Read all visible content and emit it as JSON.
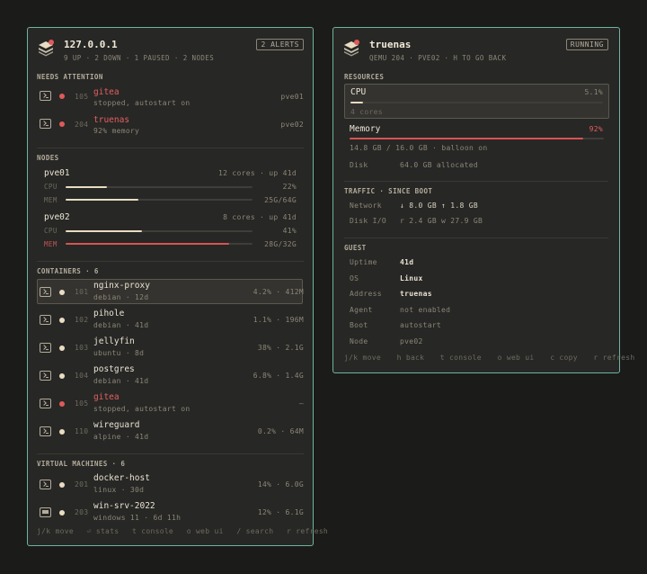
{
  "left": {
    "host": "127.0.0.1",
    "summary": "9 UP  ·  2 DOWN  ·  1 PAUSED  ·  2 NODES",
    "alerts_badge": "2 ALERTS",
    "attention": {
      "header": "NEEDS ATTENTION",
      "items": [
        {
          "id": "105",
          "name": "gitea",
          "detail": "stopped, autostart on",
          "node": "pve01"
        },
        {
          "id": "204",
          "name": "truenas",
          "detail": "92% memory",
          "node": "pve02"
        }
      ]
    },
    "nodes": {
      "header": "NODES",
      "items": [
        {
          "name": "pve01",
          "info": "12 cores  ·  up 41d",
          "cpu_label": "CPU",
          "cpu_pct": "22%",
          "cpu_level": 0.22,
          "mem_label": "MEM",
          "mem_val": "25G/64G",
          "mem_level": 0.39
        },
        {
          "name": "pve02",
          "info": "8 cores  ·  up 41d",
          "cpu_label": "CPU",
          "cpu_pct": "41%",
          "cpu_level": 0.41,
          "mem_label": "MEM",
          "mem_val": "28G/32G",
          "mem_level": 0.875
        }
      ]
    },
    "containers": {
      "header": "CONTAINERS  ·  6",
      "items": [
        {
          "id": "101",
          "name": "nginx-proxy",
          "sub": "debian  ·  12d",
          "stat": "4.2%  ·  412M",
          "status": "ok"
        },
        {
          "id": "102",
          "name": "pihole",
          "sub": "debian  ·  41d",
          "stat": "1.1%  ·  196M",
          "status": "ok"
        },
        {
          "id": "103",
          "name": "jellyfin",
          "sub": "ubuntu  ·  8d",
          "stat": "38%  ·  2.1G",
          "status": "ok"
        },
        {
          "id": "104",
          "name": "postgres",
          "sub": "debian  ·  41d",
          "stat": "6.8%  ·  1.4G",
          "status": "ok"
        },
        {
          "id": "105",
          "name": "gitea",
          "sub": "stopped, autostart on",
          "stat": "—",
          "status": "down"
        },
        {
          "id": "110",
          "name": "wireguard",
          "sub": "alpine  ·  41d",
          "stat": "0.2%  ·  64M",
          "status": "ok"
        }
      ]
    },
    "vms": {
      "header": "VIRTUAL MACHINES  ·  6",
      "items": [
        {
          "id": "201",
          "name": "docker-host",
          "sub": "linux  ·  30d",
          "stat": "14%  ·  6.0G",
          "icon": "terminal-icon"
        },
        {
          "id": "203",
          "name": "win-srv-2022",
          "sub": "windows 11  ·  6d 11h",
          "stat": "12%  ·  6.1G",
          "icon": "monitor-icon"
        }
      ]
    },
    "footer": [
      "j/k move",
      "⏎ stats",
      "t console",
      "o web ui",
      "/ search",
      "r refresh"
    ]
  },
  "right": {
    "title": "truenas",
    "subtitle": "QEMU 204  ·  PVE02  ·  H TO GO BACK",
    "status_badge": "RUNNING",
    "resources": {
      "header": "RESOURCES",
      "cpu_label": "CPU",
      "cpu_pct": "5.1%",
      "cpu_level": 0.051,
      "cpu_sub": "4 cores",
      "mem_label": "Memory",
      "mem_pct": "92%",
      "mem_level": 0.92,
      "mem_sub": "14.8 GB / 16.0 GB  ·  balloon on",
      "disk_label": "Disk",
      "disk_val": "64.0 GB allocated"
    },
    "traffic": {
      "header": "TRAFFIC  ·  SINCE BOOT",
      "net_label": "Network",
      "net_val": "↓ 8.0 GB   ↑ 1.8 GB",
      "io_label": "Disk I/O",
      "io_val": "r 2.4 GB   w 27.9 GB"
    },
    "guest": {
      "header": "GUEST",
      "rows": [
        {
          "k": "Uptime",
          "v": "41d",
          "bright": true
        },
        {
          "k": "OS",
          "v": "Linux",
          "bright": true
        },
        {
          "k": "Address",
          "v": "truenas",
          "bright": true
        },
        {
          "k": "Agent",
          "v": "not enabled",
          "bright": false
        },
        {
          "k": "Boot",
          "v": "autostart",
          "bright": false
        },
        {
          "k": "Node",
          "v": "pve02",
          "bright": false
        }
      ]
    },
    "footer": [
      "j/k move",
      "h back",
      "t console",
      "o web ui",
      "c copy",
      "r refresh"
    ]
  },
  "colors": {
    "accent": "#6fb3a0",
    "alert": "#e05a5a",
    "bar": "#e8dcc2",
    "panel": "#272725",
    "bg": "#1b1b1a"
  }
}
